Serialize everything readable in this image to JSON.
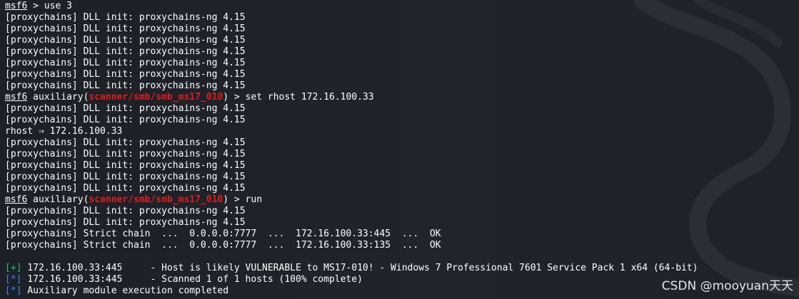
{
  "terminal": {
    "lines": [
      {
        "type": "prompt-simple",
        "prompt": "msf6",
        "rest": " > use 3"
      },
      {
        "type": "text",
        "text": "[proxychains] DLL init: proxychains-ng 4.15"
      },
      {
        "type": "text",
        "text": "[proxychains] DLL init: proxychains-ng 4.15"
      },
      {
        "type": "text",
        "text": "[proxychains] DLL init: proxychains-ng 4.15"
      },
      {
        "type": "text",
        "text": "[proxychains] DLL init: proxychains-ng 4.15"
      },
      {
        "type": "text",
        "text": "[proxychains] DLL init: proxychains-ng 4.15"
      },
      {
        "type": "text",
        "text": "[proxychains] DLL init: proxychains-ng 4.15"
      },
      {
        "type": "text",
        "text": "[proxychains] DLL init: proxychains-ng 4.15"
      },
      {
        "type": "prompt-module",
        "prompt": "msf6",
        "pre": " auxiliary(",
        "module": "scanner/smb/smb_ms17_010",
        "post": ") > set rhost 172.16.100.33"
      },
      {
        "type": "text",
        "text": "[proxychains] DLL init: proxychains-ng 4.15"
      },
      {
        "type": "text",
        "text": "[proxychains] DLL init: proxychains-ng 4.15"
      },
      {
        "type": "text",
        "text": "rhost ⇒ 172.16.100.33"
      },
      {
        "type": "text",
        "text": "[proxychains] DLL init: proxychains-ng 4.15"
      },
      {
        "type": "text",
        "text": "[proxychains] DLL init: proxychains-ng 4.15"
      },
      {
        "type": "text",
        "text": "[proxychains] DLL init: proxychains-ng 4.15"
      },
      {
        "type": "text",
        "text": "[proxychains] DLL init: proxychains-ng 4.15"
      },
      {
        "type": "text",
        "text": "[proxychains] DLL init: proxychains-ng 4.15"
      },
      {
        "type": "prompt-module",
        "prompt": "msf6",
        "pre": " auxiliary(",
        "module": "scanner/smb/smb_ms17_010",
        "post": ") > run"
      },
      {
        "type": "text",
        "text": "[proxychains] DLL init: proxychains-ng 4.15"
      },
      {
        "type": "text",
        "text": "[proxychains] DLL init: proxychains-ng 4.15"
      },
      {
        "type": "text",
        "text": "[proxychains] Strict chain  ...  0.0.0.0:7777  ...  172.16.100.33:445  ...  OK"
      },
      {
        "type": "text",
        "text": "[proxychains] Strict chain  ...  0.0.0.0:7777  ...  172.16.100.33:135  ...  OK"
      },
      {
        "type": "blank",
        "text": ""
      },
      {
        "type": "status",
        "tag": "[+]",
        "tagclass": "tag-plus",
        "text": " 172.16.100.33:445     - Host is likely VULNERABLE to MS17-010! - Windows 7 Professional 7601 Service Pack 1 x64 (64-bit)"
      },
      {
        "type": "status",
        "tag": "[*]",
        "tagclass": "tag-star",
        "text": " 172.16.100.33:445     - Scanned 1 of 1 hosts (100% complete)"
      },
      {
        "type": "status",
        "tag": "[*]",
        "tagclass": "tag-star",
        "text": " Auxiliary module execution completed"
      }
    ]
  },
  "watermark": {
    "text": "CSDN @mooyuan天天"
  },
  "colors": {
    "background": "#1f2229",
    "text": "#ffffff",
    "module": "#e21b1b",
    "success": "#22c55e",
    "info": "#3b82f6"
  }
}
